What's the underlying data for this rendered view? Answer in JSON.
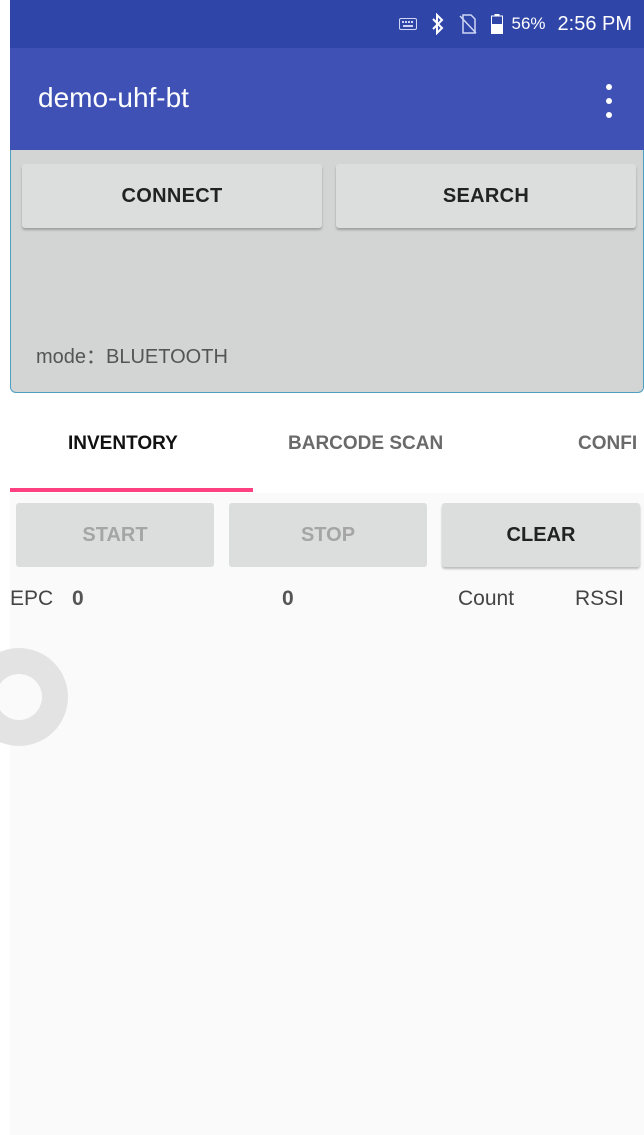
{
  "status_bar": {
    "icons": [
      "keyboard-icon",
      "bluetooth-icon",
      "no-sim-icon",
      "battery-icon"
    ],
    "battery": "56%",
    "time": "2:56 PM"
  },
  "app_bar": {
    "title": "demo-uhf-bt",
    "menu_icon": "overflow-menu-icon"
  },
  "connect_panel": {
    "connect_label": "CONNECT",
    "search_label": "SEARCH",
    "mode_text": "mode：BLUETOOTH"
  },
  "tabs": [
    {
      "label": "INVENTORY",
      "selected": true
    },
    {
      "label": "BARCODE SCAN",
      "selected": false
    },
    {
      "label": "CONFI",
      "selected": false
    }
  ],
  "actions": {
    "start_label": "START",
    "stop_label": "STOP",
    "clear_label": "CLEAR"
  },
  "inventory": {
    "epc_label": "EPC",
    "epc_count": "0",
    "unique_count": "0",
    "count_label": "Count",
    "rssi_label": "RSSI"
  },
  "colors": {
    "status_bar": "#2f45a8",
    "app_bar": "#3f51b5",
    "tab_indicator": "#ff4081",
    "panel": "#d3d4d4"
  }
}
